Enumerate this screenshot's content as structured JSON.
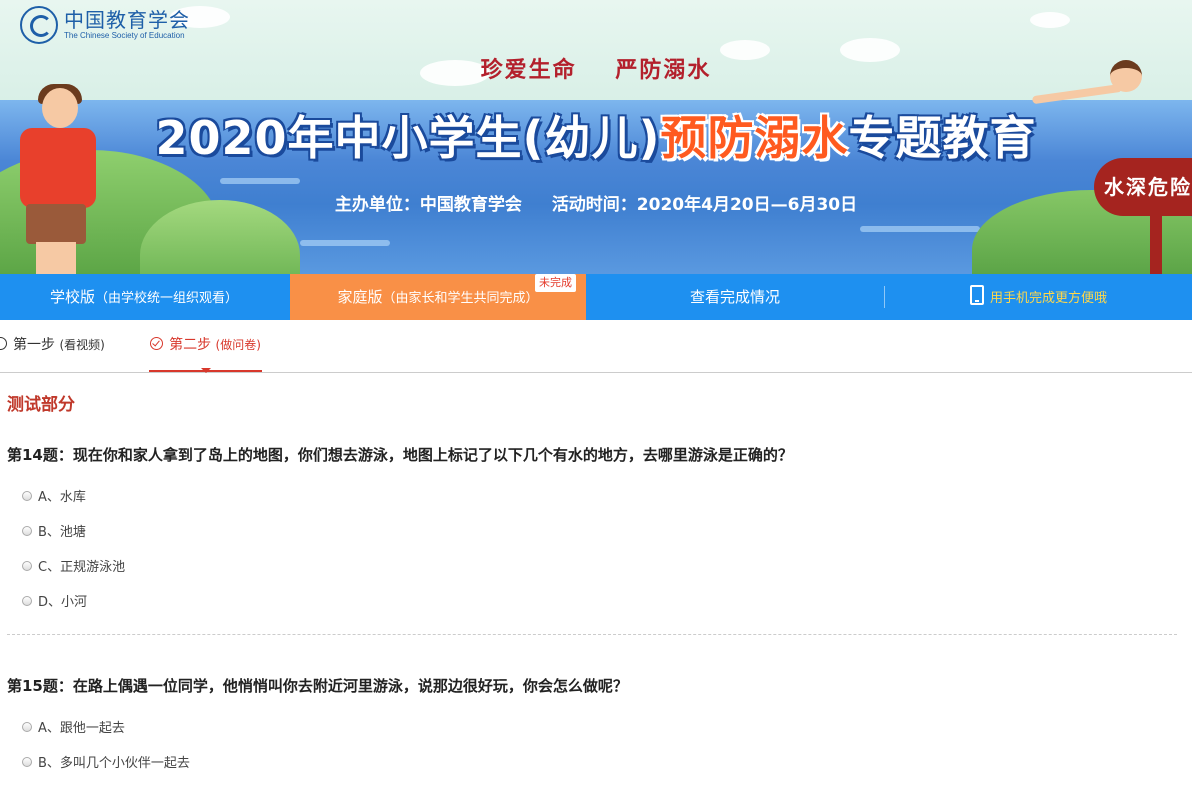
{
  "header": {
    "logo_cn": "中国教育学会",
    "logo_en": "The Chinese Society of Education",
    "slogan_1": "珍爱生命",
    "slogan_2": "严防溺水",
    "title_part1": "2020年中小学生(幼儿)",
    "title_highlight": "预防溺水",
    "title_part2": "专题教育",
    "organizer": "主办单位：中国教育学会",
    "period": "活动时间：2020年4月20日—6月30日",
    "sign_text": "水深危险"
  },
  "nav": {
    "school": "学校版",
    "school_note": "（由学校统一组织观看）",
    "family": "家庭版",
    "family_note": "（由家长和学生共同完成）",
    "family_badge": "未完成",
    "progress": "查看完成情况",
    "mobile": "用手机完成更方便哦"
  },
  "steps": {
    "step1": "第一步",
    "step1_note": "(看视频)",
    "step2": "第二步",
    "step2_note": "(做问卷)"
  },
  "section_title": "测试部分",
  "questions": [
    {
      "text": "第14题：现在你和家人拿到了岛上的地图，你们想去游泳，地图上标记了以下几个有水的地方，去哪里游泳是正确的？",
      "options": [
        "A、水库",
        "B、池塘",
        "C、正规游泳池",
        "D、小河"
      ]
    },
    {
      "text": "第15题：在路上偶遇一位同学，他悄悄叫你去附近河里游泳，说那边很好玩，你会怎么做呢？",
      "options": [
        "A、跟他一起去",
        "B、多叫几个小伙伴一起去"
      ]
    }
  ],
  "colors": {
    "nav_blue": "#1e90f0",
    "nav_active": "#f99047",
    "accent_red": "#d8382c"
  }
}
